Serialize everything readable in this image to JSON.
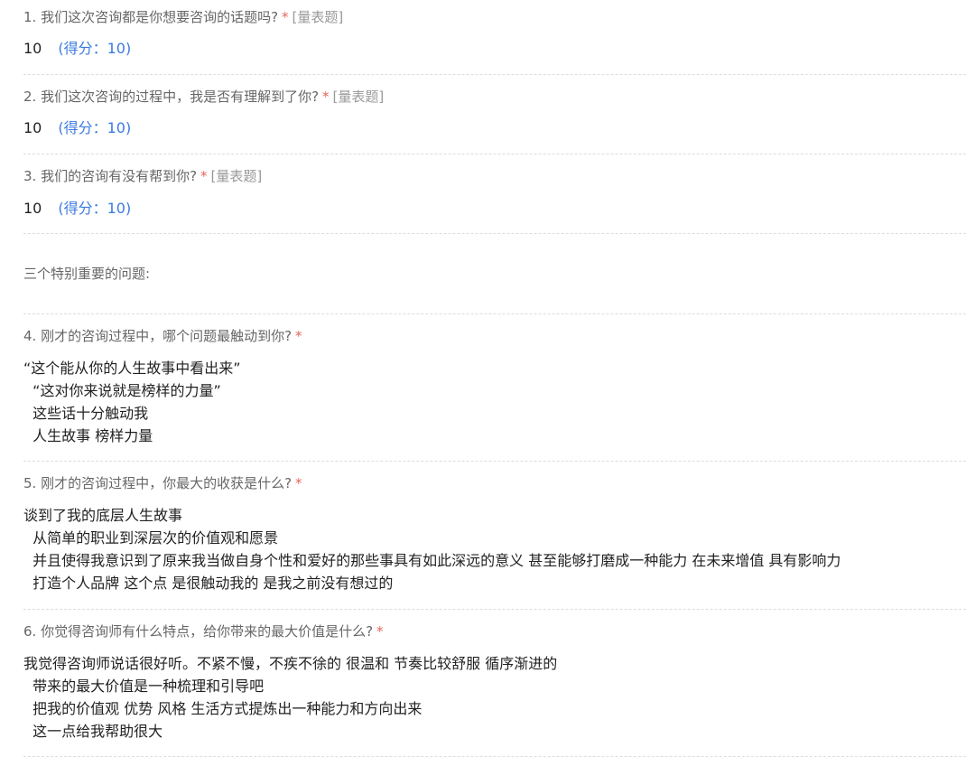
{
  "questions": [
    {
      "title": "1. 我们这次咨询都是你想要咨询的话题吗?",
      "required_mark": "*",
      "type_tag": "[量表题]",
      "value": "10",
      "score": "(得分：10)"
    },
    {
      "title": "2. 我们这次咨询的过程中，我是否有理解到了你?",
      "required_mark": "*",
      "type_tag": "[量表题]",
      "value": "10",
      "score": "(得分：10)"
    },
    {
      "title": "3. 我们的咨询有没有帮到你?",
      "required_mark": "*",
      "type_tag": "[量表题]",
      "value": "10",
      "score": "(得分：10)"
    }
  ],
  "section": {
    "title": "三个特别重要的问题:"
  },
  "open_questions": [
    {
      "title": "4. 刚才的咨询过程中，哪个问题最触动到你?",
      "required_mark": "*",
      "answer_lines": [
        "“这个能从你的人生故事中看出来”",
        "  “这对你来说就是榜样的力量”",
        "  这些话十分触动我",
        "  人生故事 榜样力量"
      ]
    },
    {
      "title": "5. 刚才的咨询过程中，你最大的收获是什么?",
      "required_mark": "*",
      "answer_lines": [
        "谈到了我的底层人生故事",
        "  从简单的职业到深层次的价值观和愿景",
        "  并且使得我意识到了原来我当做自身个性和爱好的那些事具有如此深远的意义 甚至能够打磨成一种能力 在未来增值 具有影响力",
        "  打造个人品牌 这个点 是很触动我的 是我之前没有想过的"
      ]
    },
    {
      "title": "6. 你觉得咨询师有什么特点，给你带来的最大价值是什么?",
      "required_mark": "*",
      "answer_lines": [
        "我觉得咨询师说话很好听。不紧不慢，不疾不徐的 很温和 节奏比较舒服 循序渐进的",
        "  带来的最大价值是一种梳理和引导吧",
        "  把我的价值观 优势 风格 生活方式提炼出一种能力和方向出来",
        "  这一点给我帮助很大"
      ]
    }
  ],
  "colors": {
    "required": "#e8645a",
    "type_tag": "#999999",
    "score": "#3b7be0",
    "divider": "#dddddd"
  }
}
